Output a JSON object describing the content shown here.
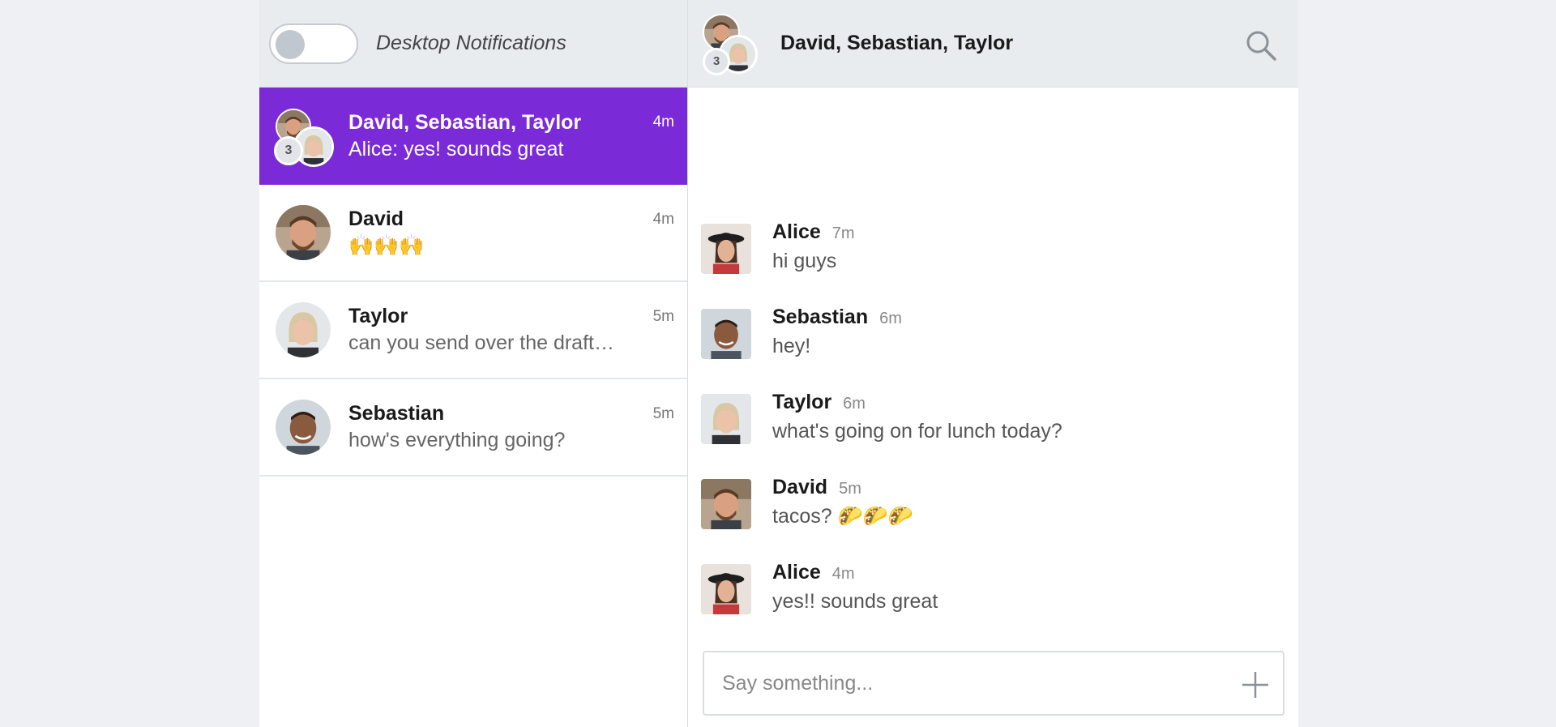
{
  "notifications": {
    "label": "Desktop Notifications",
    "enabled": false
  },
  "conversations": [
    {
      "name": "David, Sebastian, Taylor",
      "preview": "Alice: yes! sounds great",
      "time": "4m",
      "group_count": "3",
      "active": true
    },
    {
      "name": "David",
      "preview": "🙌🙌🙌",
      "time": "4m"
    },
    {
      "name": "Taylor",
      "preview": "can you send over the drafts for …",
      "time": "5m"
    },
    {
      "name": "Sebastian",
      "preview": "how's everything going?",
      "time": "5m"
    }
  ],
  "chat": {
    "title": "David, Sebastian, Taylor",
    "group_count": "3",
    "messages": [
      {
        "author": "Alice",
        "time": "7m",
        "text": "hi guys"
      },
      {
        "author": "Sebastian",
        "time": "6m",
        "text": "hey!"
      },
      {
        "author": "Taylor",
        "time": "6m",
        "text": "what's going on for lunch today?"
      },
      {
        "author": "David",
        "time": "5m",
        "text": "tacos? 🌮🌮🌮"
      },
      {
        "author": "Alice",
        "time": "4m",
        "text": "yes!! sounds great"
      }
    ],
    "composer_placeholder": "Say something..."
  },
  "colors": {
    "accent": "#7a2ad6",
    "header_bg": "#e8ecef",
    "page_bg": "#eef0f4"
  },
  "icons": {
    "search": "search-icon",
    "add": "plus-icon"
  }
}
